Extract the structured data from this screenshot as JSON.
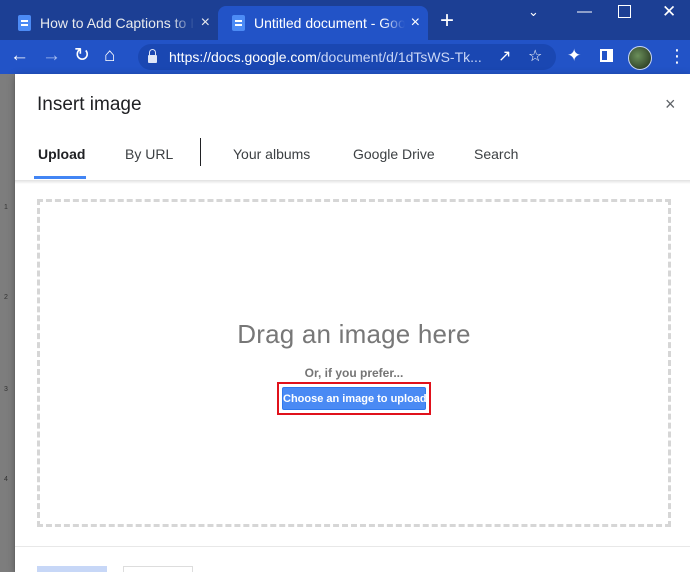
{
  "browser": {
    "tabs": [
      {
        "title": "How to Add Captions to Ima",
        "close": "×",
        "active": false
      },
      {
        "title": "Untitled document - Google",
        "close": "×",
        "active": true
      }
    ],
    "new_tab": "+",
    "url_host": "https://docs.google.com",
    "url_path": "/document/d/1dTsWS-Tk..."
  },
  "dialog": {
    "title": "Insert image",
    "close": "×",
    "tabs": [
      "Upload",
      "By URL",
      "Your albums",
      "Google Drive",
      "Search"
    ],
    "selected_tab": "Upload",
    "drag_text": "Drag an image here",
    "prefer_text": "Or, if you prefer...",
    "upload_button": "Choose an image to upload"
  },
  "ruler": [
    "1",
    "2",
    "3",
    "4"
  ],
  "colors": {
    "tabstrip": "#1c3f94",
    "toolbar": "#2253c7",
    "accent": "#4285f4",
    "highlight": "#e0111b"
  }
}
